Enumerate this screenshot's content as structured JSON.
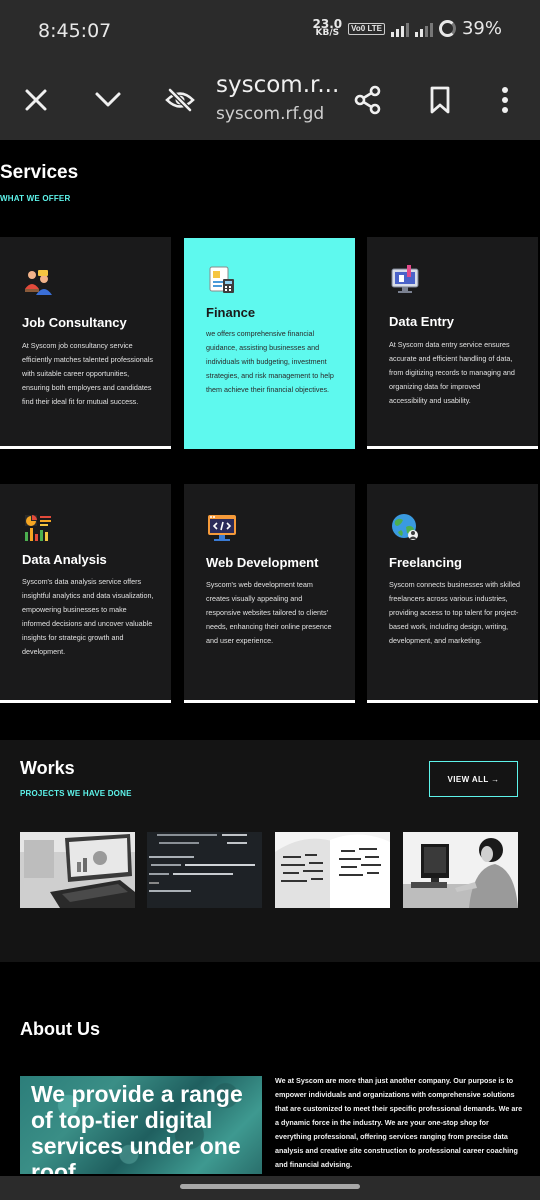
{
  "status": {
    "time": "8:45:07",
    "net_speed_value": "23.0",
    "net_speed_unit": "KB/S",
    "volte": "Vo0 LTE",
    "network": "4G",
    "battery": "39%"
  },
  "browser": {
    "page_title": "syscom.r...",
    "url": "syscom.rf.gd"
  },
  "services": {
    "title": "Services",
    "subtitle": "WHAT WE OFFER",
    "cards": [
      {
        "title": "Job Consultancy",
        "text": "At Syscom job consultancy service efficiently matches talented professionals with suitable career opportunities, ensuring both employers and candidates find their ideal fit for mutual success.",
        "icon": "consultancy-icon"
      },
      {
        "title": "Finance",
        "text": "we offers comprehensive financial guidance, assisting businesses and individuals with budgeting, investment strategies, and risk management to help them achieve their financial objectives.",
        "icon": "finance-icon"
      },
      {
        "title": "Data Entry",
        "text": "At Syscom data entry service ensures accurate and efficient handling of data, from digitizing records to managing and organizing data for improved accessibility and usability.",
        "icon": "data-entry-icon"
      },
      {
        "title": "Data Analysis",
        "text": "Syscom's data analysis service offers insightful analytics and data visualization, empowering businesses to make informed decisions and uncover valuable insights for strategic growth and development.",
        "icon": "data-analysis-icon"
      },
      {
        "title": "Web Development",
        "text": "Syscom's web development team creates visually appealing and responsive websites tailored to clients' needs, enhancing their online presence and user experience.",
        "icon": "web-development-icon"
      },
      {
        "title": "Freelancing",
        "text": "Syscom connects businesses with skilled freelancers across various industries, providing access to top talent for project-based work, including design, writing, development, and marketing.",
        "icon": "freelancing-icon"
      }
    ]
  },
  "works": {
    "title": "Works",
    "subtitle": "PROJECTS WE HAVE DONE",
    "view_all": "VIEW ALL →"
  },
  "about": {
    "title": "About Us",
    "hero_text": "We provide a range of top-tier digital services under one roof",
    "body": "We at Syscom are more than just another company. Our purpose is to empower individuals and organizations with comprehensive solutions that are customized to meet their specific professional demands. We are a dynamic force in the industry. We are your one-stop shop for everything professional, offering services ranging from precise data analysis and creative site construction to professional career coaching and financial advising."
  },
  "colors": {
    "accent": "#5ef9ee",
    "card_bg": "#1a1a1b",
    "chrome_bg": "#2b2b2b"
  }
}
